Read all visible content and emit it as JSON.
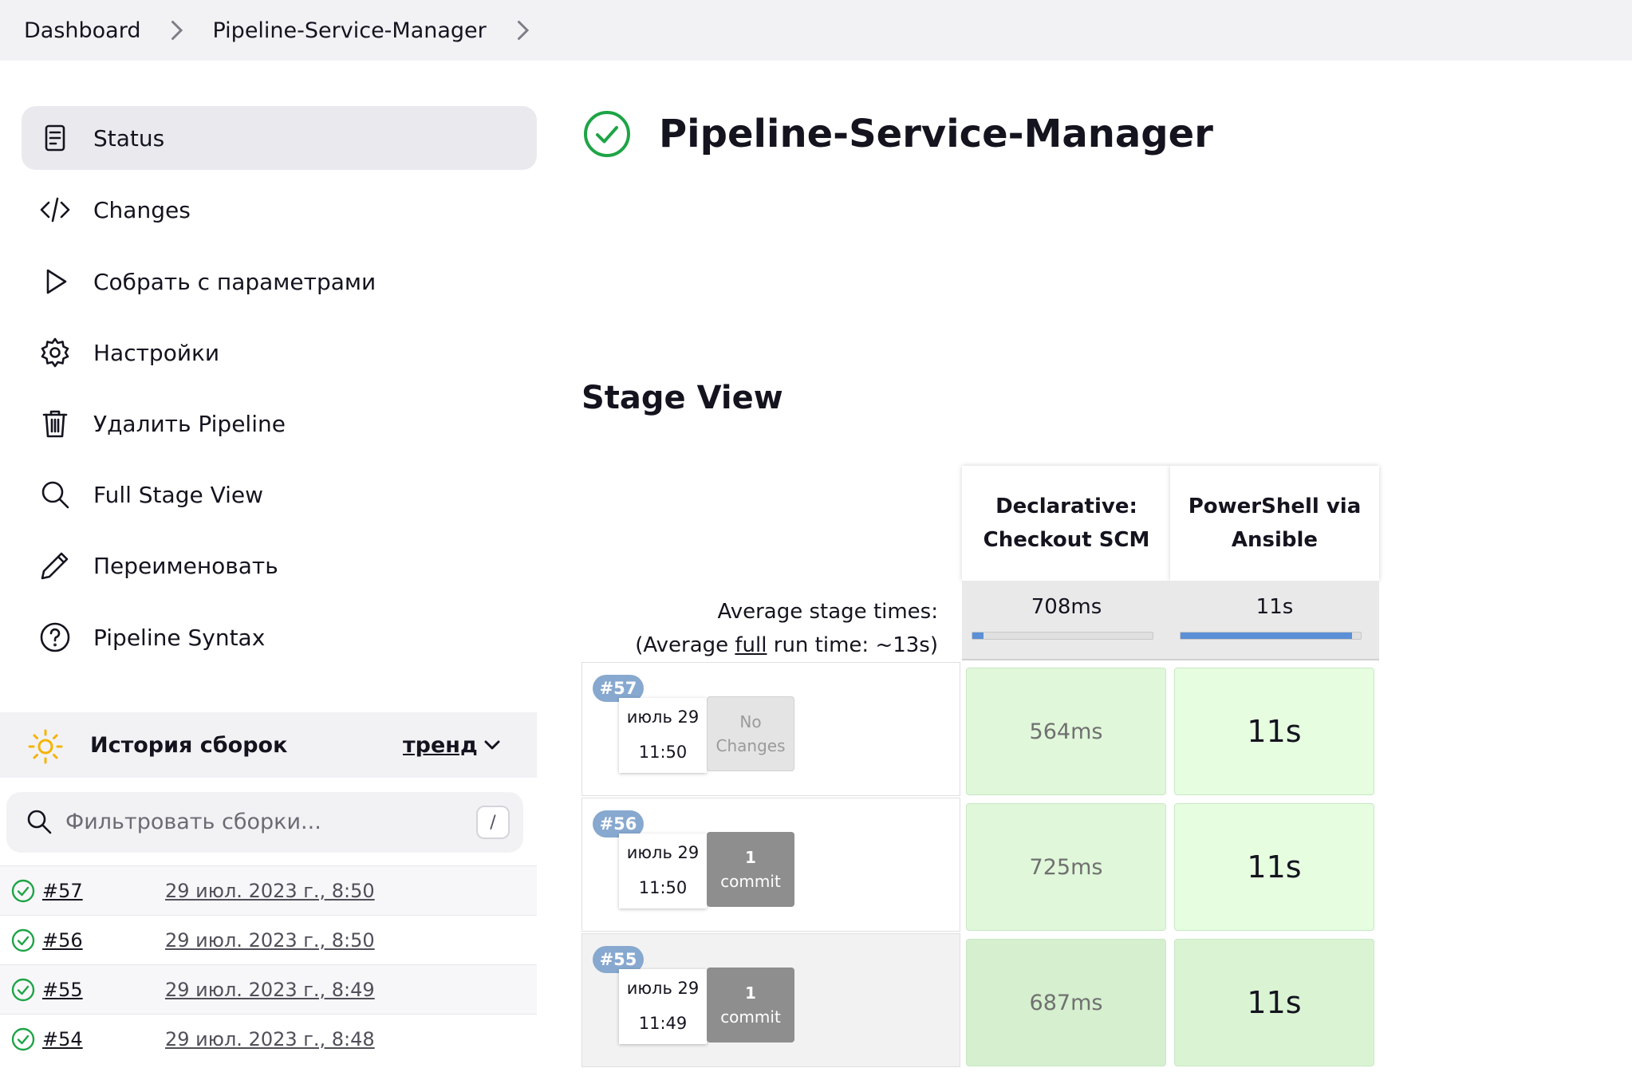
{
  "breadcrumb": {
    "items": [
      "Dashboard",
      "Pipeline-Service-Manager"
    ]
  },
  "sidebar": {
    "items": [
      {
        "label": "Status",
        "icon": "document-icon",
        "active": true
      },
      {
        "label": "Changes",
        "icon": "code-icon"
      },
      {
        "label": "Собрать с параметрами",
        "icon": "play-icon"
      },
      {
        "label": "Настройки",
        "icon": "gear-icon"
      },
      {
        "label": "Удалить Pipeline",
        "icon": "trash-icon"
      },
      {
        "label": "Full Stage View",
        "icon": "search-icon"
      },
      {
        "label": "Переименовать",
        "icon": "pencil-icon"
      },
      {
        "label": "Pipeline Syntax",
        "icon": "help-circle-icon"
      }
    ]
  },
  "history": {
    "title": "История сборок",
    "trend_label": "тренд",
    "filter_placeholder": "Фильтровать сборки...",
    "filter_shortcut": "/",
    "builds": [
      {
        "number": "#57",
        "date": "29 июл. 2023 г., 8:50",
        "status": "success"
      },
      {
        "number": "#56",
        "date": "29 июл. 2023 г., 8:50",
        "status": "success"
      },
      {
        "number": "#55",
        "date": "29 июл. 2023 г., 8:49",
        "status": "success"
      },
      {
        "number": "#54",
        "date": "29 июл. 2023 г., 8:48",
        "status": "success"
      }
    ]
  },
  "main": {
    "title": "Pipeline-Service-Manager",
    "status": "success",
    "stage_view_title": "Stage View"
  },
  "stage_view": {
    "stages": [
      {
        "name_line1": "Declarative:",
        "name_line2": "Checkout SCM",
        "avg_time": "708ms",
        "avg_bar_fraction": 0.06
      },
      {
        "name_line1": "PowerShell via",
        "name_line2": "Ansible",
        "avg_time": "11s",
        "avg_bar_fraction": 0.95
      }
    ],
    "avg_label_line1": "Average stage times:",
    "avg_label_prefix": "(Average ",
    "avg_label_link": "full",
    "avg_label_suffix": " run time: ~13s)",
    "runs": [
      {
        "badge": "#57",
        "date": "июль 29",
        "time": "11:50",
        "changes_line1": "No",
        "changes_line2": "Changes",
        "has_commits": false,
        "times": [
          "564ms",
          "11s"
        ]
      },
      {
        "badge": "#56",
        "date": "июль 29",
        "time": "11:50",
        "changes_line1": "1",
        "changes_line2": "commit",
        "has_commits": true,
        "times": [
          "725ms",
          "11s"
        ]
      },
      {
        "badge": "#55",
        "date": "июль 29",
        "time": "11:49",
        "changes_line1": "1",
        "changes_line2": "commit",
        "has_commits": true,
        "times": [
          "687ms",
          "11s"
        ]
      }
    ]
  },
  "colors": {
    "success_green": "#1ea446",
    "stage_cell_green": "#e0f7da",
    "stage_cell_green_shaded": "#d5efcf",
    "sun_yellow": "#f5b400",
    "badge_blue": "#87a8cf"
  }
}
